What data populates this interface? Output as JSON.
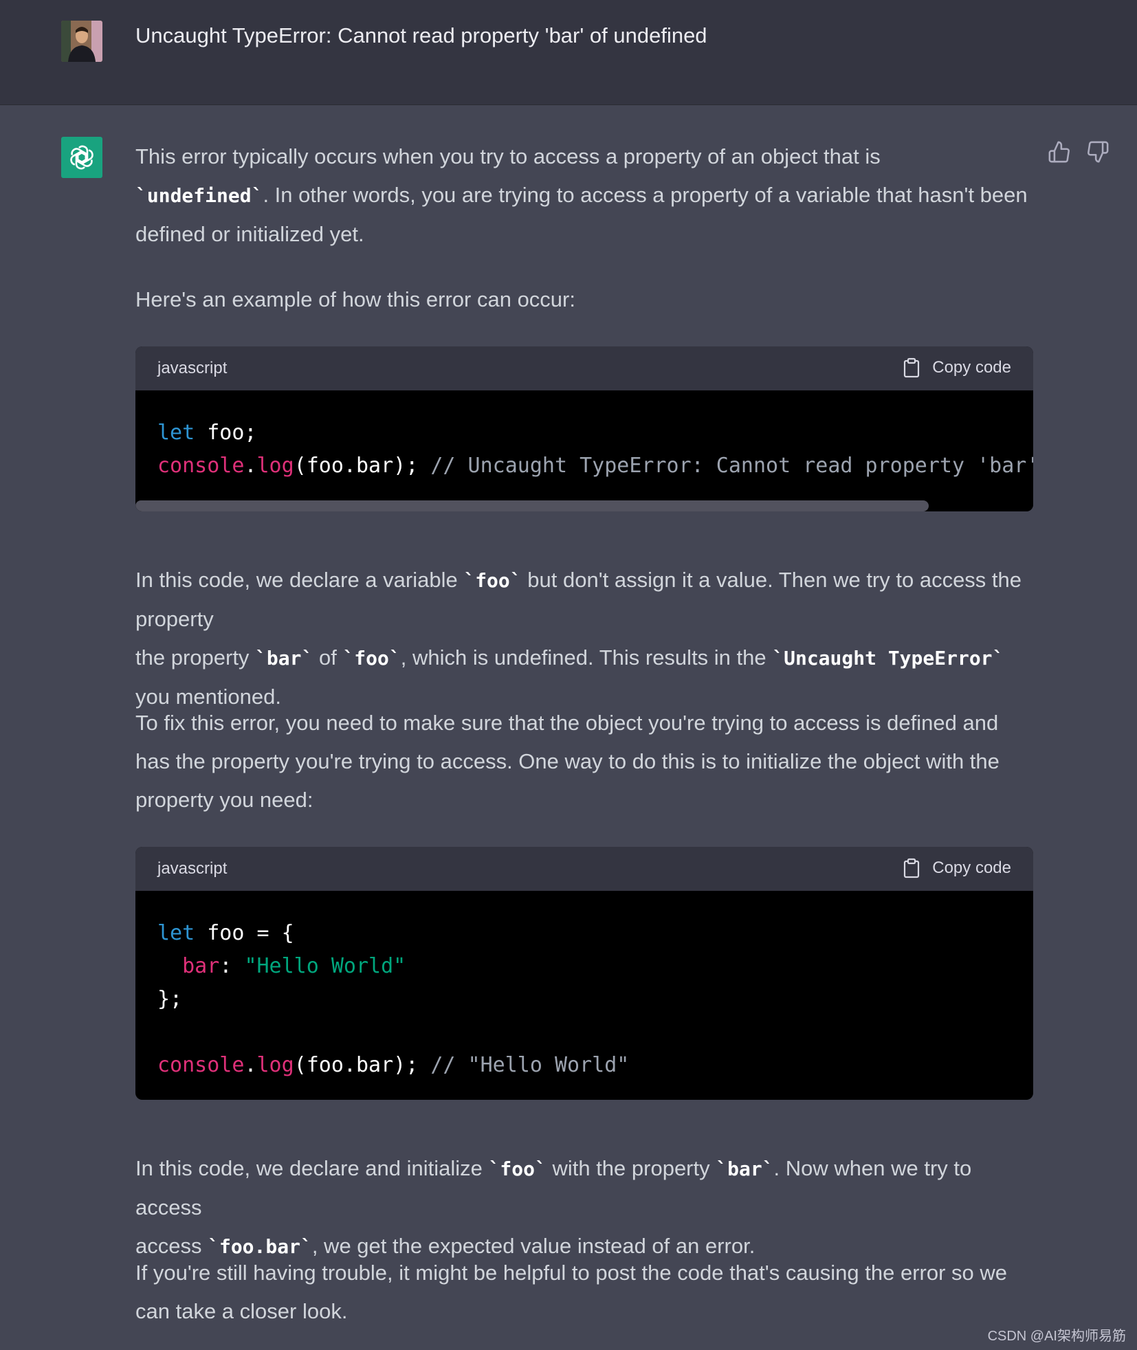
{
  "user_message": "Uncaught TypeError: Cannot read property 'bar' of undefined",
  "response": {
    "p1": [
      "This error typically occurs when you try to access a property of an object that is",
      "`undefined`",
      ". In other words, you are trying to access a property of a variable that hasn't been defined or initialized yet."
    ],
    "p2": "Here's an example of how this error can occur:",
    "code1": {
      "lang": "javascript",
      "copy_label": "Copy code",
      "line1": {
        "kw": "let",
        "rest": " foo;"
      },
      "line2": {
        "obj": "console",
        "dot": ".",
        "fn": "log",
        "args": "(foo.bar); ",
        "comment": "// Uncaught TypeError: Cannot read property 'bar' of undefined"
      }
    },
    "p3": [
      "In this code, we declare a variable",
      "`foo`",
      "but don't assign it a value. Then we try to access the property",
      "`bar`",
      "of",
      "`foo`",
      ", which is undefined. This results in the",
      "`Uncaught TypeError`",
      "you mentioned."
    ],
    "p4": "To fix this error, you need to make sure that the object you're trying to access is defined and has the property you're trying to access. One way to do this is to initialize the object with the property you need:",
    "code2": {
      "lang": "javascript",
      "copy_label": "Copy code",
      "l1_kw": "let",
      "l1_rest": " foo = {",
      "l2_prop": "bar",
      "l2_colon": ": ",
      "l2_str": "\"Hello World\"",
      "l3": "};",
      "l5_obj": "console",
      "l5_dot": ".",
      "l5_fn": "log",
      "l5_args": "(foo.bar); ",
      "l5_comment": "// \"Hello World\""
    },
    "p5": [
      "In this code, we declare and initialize",
      "`foo`",
      "with the property",
      "`bar`",
      ". Now when we try to access",
      "`foo.bar`",
      ", we get the expected value instead of an error."
    ],
    "p6": "If you're still having trouble, it might be helpful to post the code that's causing the error so we can take a closer look."
  },
  "watermark": "CSDN @AI架构师易筋",
  "colors": {
    "user_bg": "#343541",
    "assistant_bg": "#444654",
    "gpt_green": "#19a37f",
    "keyword": "#2e95d3",
    "function": "#df3079",
    "string": "#00a67d"
  },
  "icons": [
    "user-avatar",
    "chatgpt-logo-icon",
    "thumbs-up-icon",
    "thumbs-down-icon",
    "clipboard-icon"
  ]
}
